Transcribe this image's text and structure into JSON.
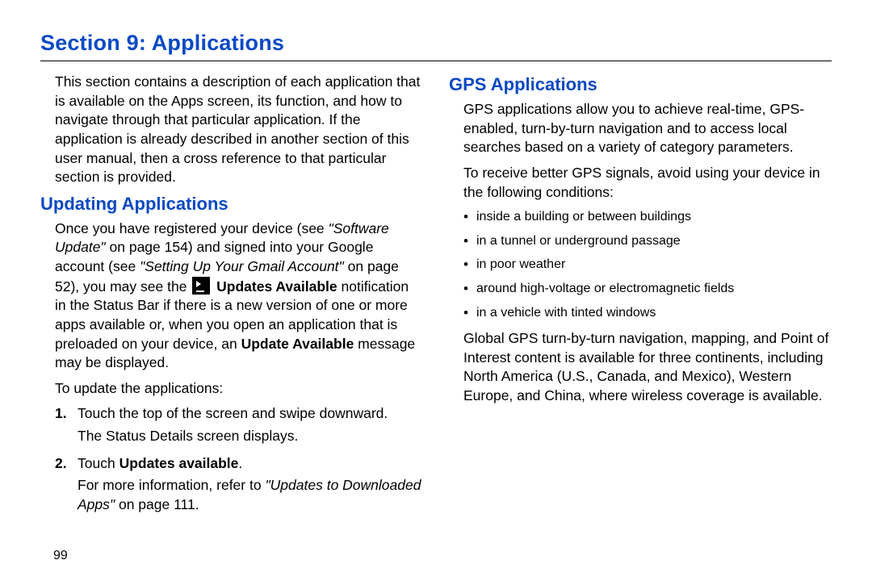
{
  "page": {
    "section_title": "Section 9: Applications",
    "page_number": "99"
  },
  "left": {
    "intro": "This section contains a description of each application that is available on the Apps screen, its function, and how to navigate through that particular application. If the application is already described in another section of this user manual, then a cross reference to that particular section is provided.",
    "heading1": "Updating Applications",
    "p1_a": "Once you have registered your device (see ",
    "p1_ref1": "\"Software Update\"",
    "p1_b": " on page 154) and signed into your Google account (see ",
    "p1_ref2": "\"Setting Up Your Gmail Account\"",
    "p1_c": " on page 52), you may see the ",
    "p1_bold1": " Updates Available",
    "p1_d": " notification in the Status Bar if there is a new version of one or more apps available or, when you open an application that is preloaded on your device, an ",
    "p1_bold2": "Update Available",
    "p1_e": " message may be displayed.",
    "p2": "To update the applications:",
    "step1_num": "1.",
    "step1_a": "Touch the top of the screen and swipe downward.",
    "step1_b": "The Status Details screen displays.",
    "step2_num": "2.",
    "step2_a_pre": "Touch ",
    "step2_a_bold": "Updates available",
    "step2_a_post": ".",
    "step2_b_pre": "For more information, refer to ",
    "step2_b_ref": "\"Updates to Downloaded Apps\"",
    "step2_b_post": " on page 111."
  },
  "right": {
    "heading1": "GPS Applications",
    "p1": "GPS applications allow you to achieve real-time, GPS-enabled, turn-by-turn navigation and to access local searches based on a variety of category parameters.",
    "p2": "To receive better GPS signals, avoid using your device in the following conditions:",
    "bullets": [
      "inside a building or between buildings",
      "in a tunnel or underground passage",
      "in poor weather",
      "around high-voltage or electromagnetic fields",
      "in a vehicle with tinted windows"
    ],
    "p3": "Global GPS turn-by-turn navigation, mapping, and Point of Interest content is available for three continents, including North America (U.S., Canada, and Mexico), Western Europe, and China, where wireless coverage is available."
  }
}
